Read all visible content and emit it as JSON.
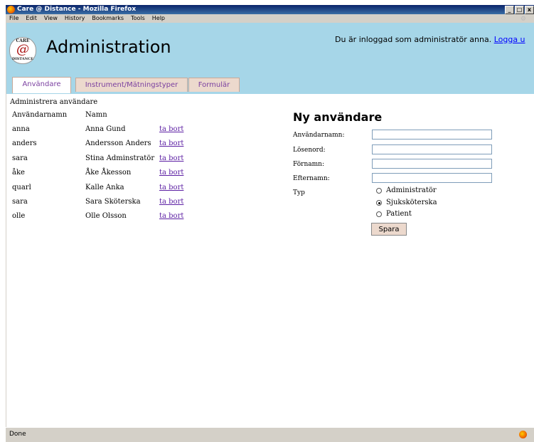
{
  "window": {
    "title": "Care @ Distance - Mozilla Firefox",
    "buttons": [
      "_",
      "□",
      "x"
    ]
  },
  "menu": [
    "File",
    "Edit",
    "View",
    "History",
    "Bookmarks",
    "Tools",
    "Help"
  ],
  "header": {
    "logo": {
      "top": "CARE",
      "at": "@",
      "bottom": "DISTANCE"
    },
    "title": "Administration",
    "login_text": "Du är inloggad som administratör anna.",
    "logout_label": "Logga u"
  },
  "tabs": [
    {
      "label": "Användare",
      "active": true
    },
    {
      "label": "Instrument/Mätningstyper",
      "active": false
    },
    {
      "label": "Formulär",
      "active": false
    }
  ],
  "users_section": {
    "heading": "Administrera användare",
    "columns": [
      "Användarnamn",
      "Namn"
    ],
    "rows": [
      {
        "username": "anna",
        "name": "Anna Gund",
        "action": "ta bort"
      },
      {
        "username": "anders",
        "name": "Andersson Anders",
        "action": "ta bort"
      },
      {
        "username": "sara",
        "name": "Stina Adminstratör",
        "action": "ta bort"
      },
      {
        "username": "åke",
        "name": "Åke Åkesson",
        "action": "ta bort"
      },
      {
        "username": "quarl",
        "name": "Kalle Anka",
        "action": "ta bort"
      },
      {
        "username": "sara",
        "name": "Sara Sköterska",
        "action": "ta bort"
      },
      {
        "username": "olle",
        "name": "Olle Olsson",
        "action": "ta bort"
      }
    ]
  },
  "new_user_form": {
    "title": "Ny användare",
    "fields": [
      {
        "label": "Användarnamn:",
        "value": ""
      },
      {
        "label": "Lösenord:",
        "value": ""
      },
      {
        "label": "Förnamn:",
        "value": ""
      },
      {
        "label": "Efternamn:",
        "value": ""
      }
    ],
    "type_label": "Typ",
    "types": [
      {
        "label": "Administratör",
        "checked": false
      },
      {
        "label": "Sjuksköterska",
        "checked": true
      },
      {
        "label": "Patient",
        "checked": false
      }
    ],
    "save_label": "Spara"
  },
  "status": {
    "text": "Done"
  }
}
